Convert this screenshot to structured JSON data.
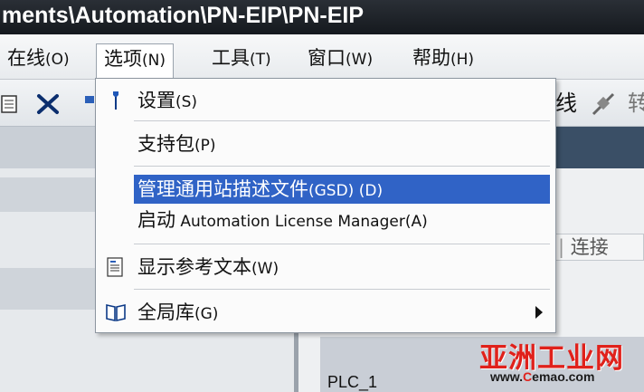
{
  "window": {
    "title": "ments\\Automation\\PN-EIP\\PN-EIP"
  },
  "menubar": {
    "items": [
      {
        "label": "在线",
        "accel": "(O)"
      },
      {
        "label": "选项",
        "accel": "(N)"
      },
      {
        "label": "工具",
        "accel": "(T)"
      },
      {
        "label": "窗口",
        "accel": "(W)"
      },
      {
        "label": "帮助",
        "accel": "(H)"
      }
    ]
  },
  "toolbar": {
    "partial_label_1": "线",
    "partial_label_2": "转"
  },
  "workspace": {
    "connections_label": "连接",
    "device_label": "PLC_1"
  },
  "dropdown": {
    "items": [
      {
        "label": "设置",
        "accel": "(S)",
        "icon": "wrench-icon"
      },
      {
        "label": "支持包",
        "accel": "(P)"
      },
      {
        "label": "管理通用站描述文件",
        "accel": "(GSD) (D)",
        "highlighted": true
      },
      {
        "label": "启动",
        "latin": " Automation License Manager",
        "accel": "(A)"
      },
      {
        "label": "显示参考文本",
        "accel": "(W)",
        "icon": "reference-text-icon"
      },
      {
        "label": "全局库",
        "accel": "(G)",
        "icon": "book-icon",
        "submenu": true
      }
    ]
  },
  "watermark": {
    "main": "亚洲工业网",
    "url_prefix": "www.",
    "url_c": "C",
    "url_rest": "emao.com"
  },
  "colors": {
    "highlight": "#3063c6",
    "watermark": "#e0211b"
  }
}
